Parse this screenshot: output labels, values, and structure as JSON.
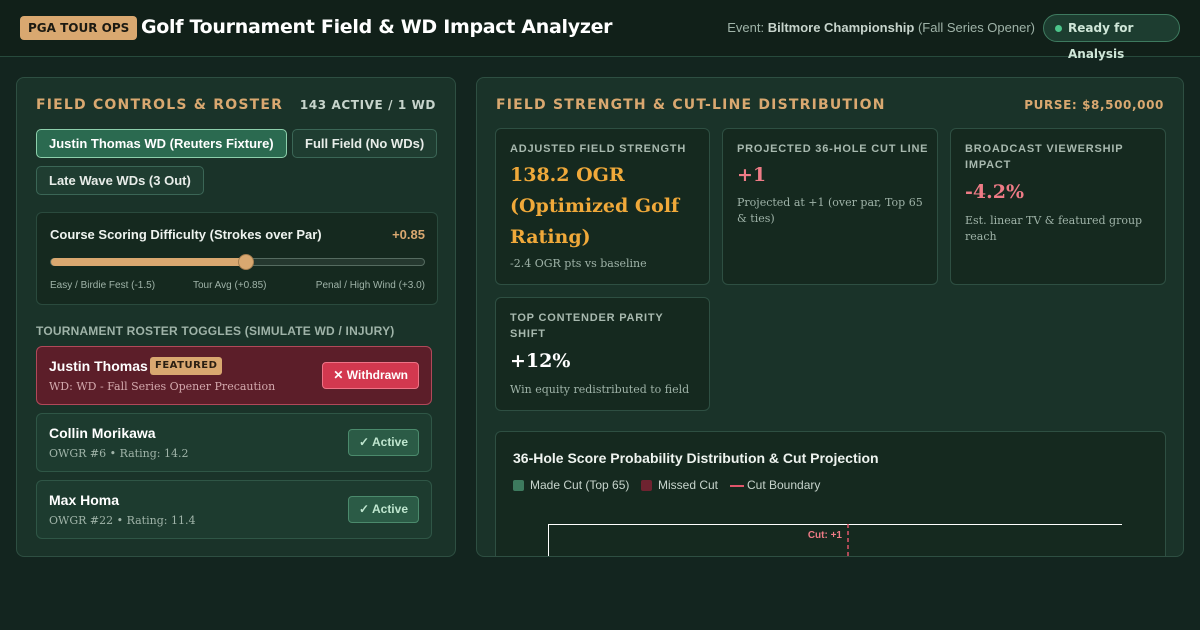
{
  "header": {
    "badge": "PGA TOUR OPS",
    "title": "Golf Tournament Field & WD Impact Analyzer",
    "event_prefix": "Event:",
    "event_name": "Biltmore Championship",
    "event_suffix": "(Fall Series Opener)",
    "status": "Ready for Analysis"
  },
  "left_panel": {
    "title": "FIELD CONTROLS & ROSTER",
    "meta": "143 ACTIVE / 1 WD",
    "scenarios": [
      {
        "label": "Justin Thomas WD (Reuters Fixture)",
        "active": true
      },
      {
        "label": "Full Field (No WDs)",
        "active": false
      },
      {
        "label": "Late Wave WDs (3 Out)",
        "active": false
      }
    ],
    "difficulty": {
      "label": "Course Scoring Difficulty (Strokes over Par)",
      "value_display": "+0.85",
      "min": -1.5,
      "max": 3.0,
      "value": 0.85,
      "ticks": [
        "Easy / Birdie Fest (-1.5)",
        "Tour Avg (+0.85)",
        "Penal / High Wind (+3.0)"
      ]
    },
    "roster_heading": "TOURNAMENT ROSTER TOGGLES (SIMULATE WD / INJURY)",
    "players": [
      {
        "name": "Justin Thomas",
        "tag": "FEATURED",
        "sub": "WD: WD - Fall Series Opener Precaution",
        "status": "✕ Withdrawn",
        "withdrawn": true
      },
      {
        "name": "Collin Morikawa",
        "tag": "",
        "sub": "OWGR #6 • Rating: 14.2",
        "status": "✓ Active",
        "withdrawn": false
      },
      {
        "name": "Max Homa",
        "tag": "",
        "sub": "OWGR #22 • Rating: 11.4",
        "status": "✓ Active",
        "withdrawn": false
      }
    ]
  },
  "right_panel": {
    "title": "FIELD STRENGTH & CUT-LINE DISTRIBUTION",
    "purse": "PURSE: $8,500,000",
    "metrics": [
      {
        "label": "ADJUSTED FIELD STRENGTH",
        "value": "138.2 OGR (Optimized Golf Rating)",
        "note": "-2.4 OGR pts vs baseline",
        "color": "#f0a93a"
      },
      {
        "label": "PROJECTED 36-HOLE CUT LINE",
        "value": "+1",
        "note": "Projected at +1 (over par, Top 65 & ties)",
        "color": "#ee7b86"
      },
      {
        "label": "BROADCAST VIEWERSHIP IMPACT",
        "value": "-4.2%",
        "note": "Est. linear TV & featured group reach",
        "color": "#ee7b86"
      },
      {
        "label": "TOP CONTENDER PARITY SHIFT",
        "value": "+12%",
        "note": "Win equity redistributed to field",
        "color": "#ffffff"
      }
    ],
    "chart": {
      "title": "36-Hole Score Probability Distribution & Cut Projection",
      "legend": [
        {
          "label": "Made Cut (Top 65)",
          "color": "#3d7a5e",
          "kind": "swatch"
        },
        {
          "label": "Missed Cut",
          "color": "#6e2330",
          "kind": "swatch"
        },
        {
          "label": "Cut Boundary",
          "color": "#e0556a",
          "kind": "line"
        }
      ],
      "cut_label": "Cut: +1"
    }
  }
}
